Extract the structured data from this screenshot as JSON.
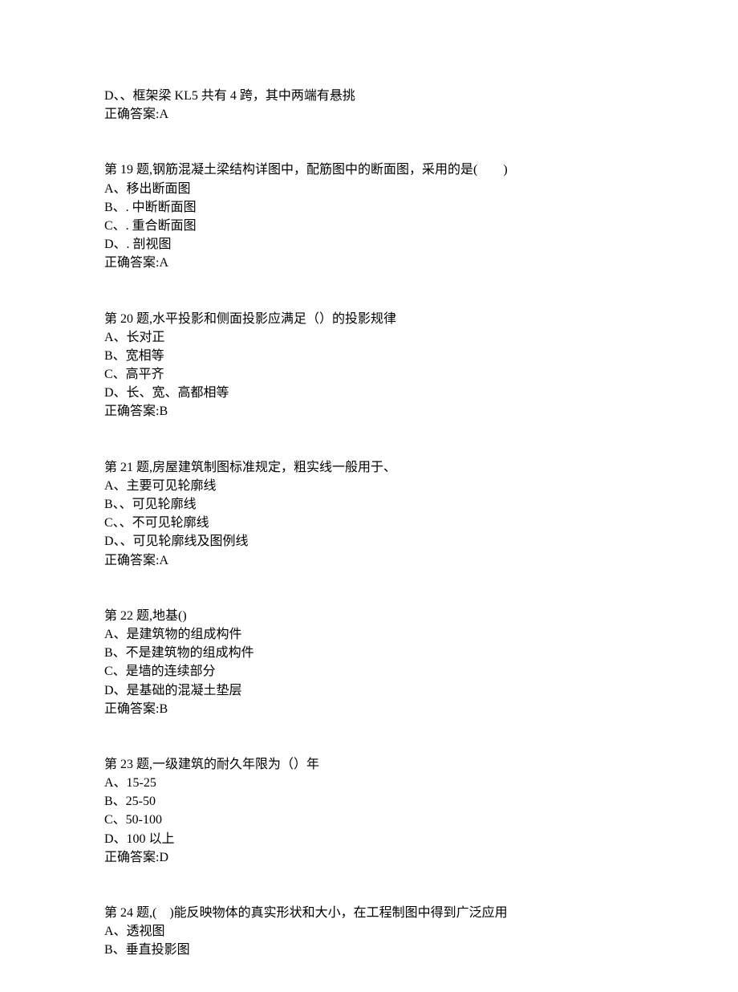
{
  "fragment": {
    "option_d": "D、、框架梁 KL5 共有 4 跨，其中两端有悬挑",
    "answer": "正确答案:A"
  },
  "questions": [
    {
      "prompt": "第 19 题,钢筋混凝土梁结构详图中，配筋图中的断面图，采用的是(　　)",
      "options": [
        "A、移出断面图",
        "B、. 中断断面图",
        "C、. 重合断面图",
        "D、. 剖视图"
      ],
      "answer": "正确答案:A"
    },
    {
      "prompt": "第 20 题,水平投影和侧面投影应满足（）的投影规律",
      "options": [
        "A、长对正",
        "B、宽相等",
        "C、高平齐",
        "D、长、宽、高都相等"
      ],
      "answer": "正确答案:B"
    },
    {
      "prompt": "第 21 题,房屋建筑制图标准规定，粗实线一般用于、",
      "options": [
        "A、主要可见轮廓线",
        "B、、可见轮廓线",
        "C、、不可见轮廓线",
        "D、、可见轮廓线及图例线"
      ],
      "answer": "正确答案:A"
    },
    {
      "prompt": "第 22 题,地基()",
      "options": [
        "A、是建筑物的组成构件",
        "B、不是建筑物的组成构件",
        "C、是墙的连续部分",
        "D、是基础的混凝土垫层"
      ],
      "answer": "正确答案:B"
    },
    {
      "prompt": "第 23 题,一级建筑的耐久年限为（）年",
      "options": [
        "A、15-25",
        "B、25-50",
        "C、50-100",
        "D、100 以上"
      ],
      "answer": "正确答案:D"
    },
    {
      "prompt": "第 24 题,(　)能反映物体的真实形状和大小，在工程制图中得到广泛应用",
      "options": [
        "A、透视图",
        "B、垂直投影图"
      ],
      "answer": ""
    }
  ]
}
